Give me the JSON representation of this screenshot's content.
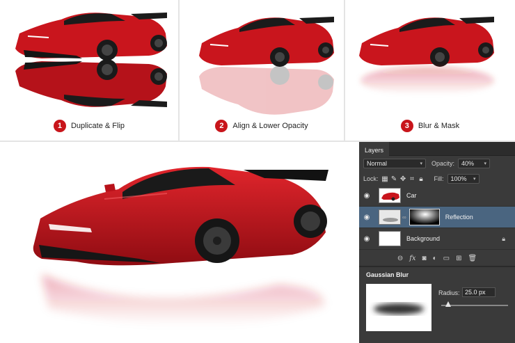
{
  "steps": [
    {
      "number": "1",
      "label": "Duplicate & Flip"
    },
    {
      "number": "2",
      "label": "Align & Lower Opacity"
    },
    {
      "number": "3",
      "label": "Blur & Mask"
    }
  ],
  "colors": {
    "accent_red": "#c8151b",
    "car_red": "#c9151d",
    "layer_selected": "#4a6580",
    "panel_bg": "#3a3a3a"
  },
  "panel": {
    "tab_label": "Layers",
    "blend_mode": "Normal",
    "opacity_label": "Opacity:",
    "opacity_value": "40%",
    "lock_label": "Lock:",
    "fill_label": "Fill:",
    "fill_value": "100%",
    "layers": [
      {
        "name": "Car",
        "visible": true,
        "selected": false
      },
      {
        "name": "Reflection",
        "visible": true,
        "selected": true
      },
      {
        "name": "Background",
        "visible": true,
        "selected": false,
        "locked": true
      }
    ],
    "bottom_icons": [
      "link-icon",
      "fx-icon",
      "mask-icon",
      "adjustment-icon",
      "folder-icon",
      "new-layer-icon",
      "trash-icon"
    ],
    "fx_label": "fx",
    "filter": {
      "title": "Gaussian Blur",
      "radius_label": "Radius:",
      "radius_value": "25.0 px",
      "radius_level": 0.1
    }
  }
}
